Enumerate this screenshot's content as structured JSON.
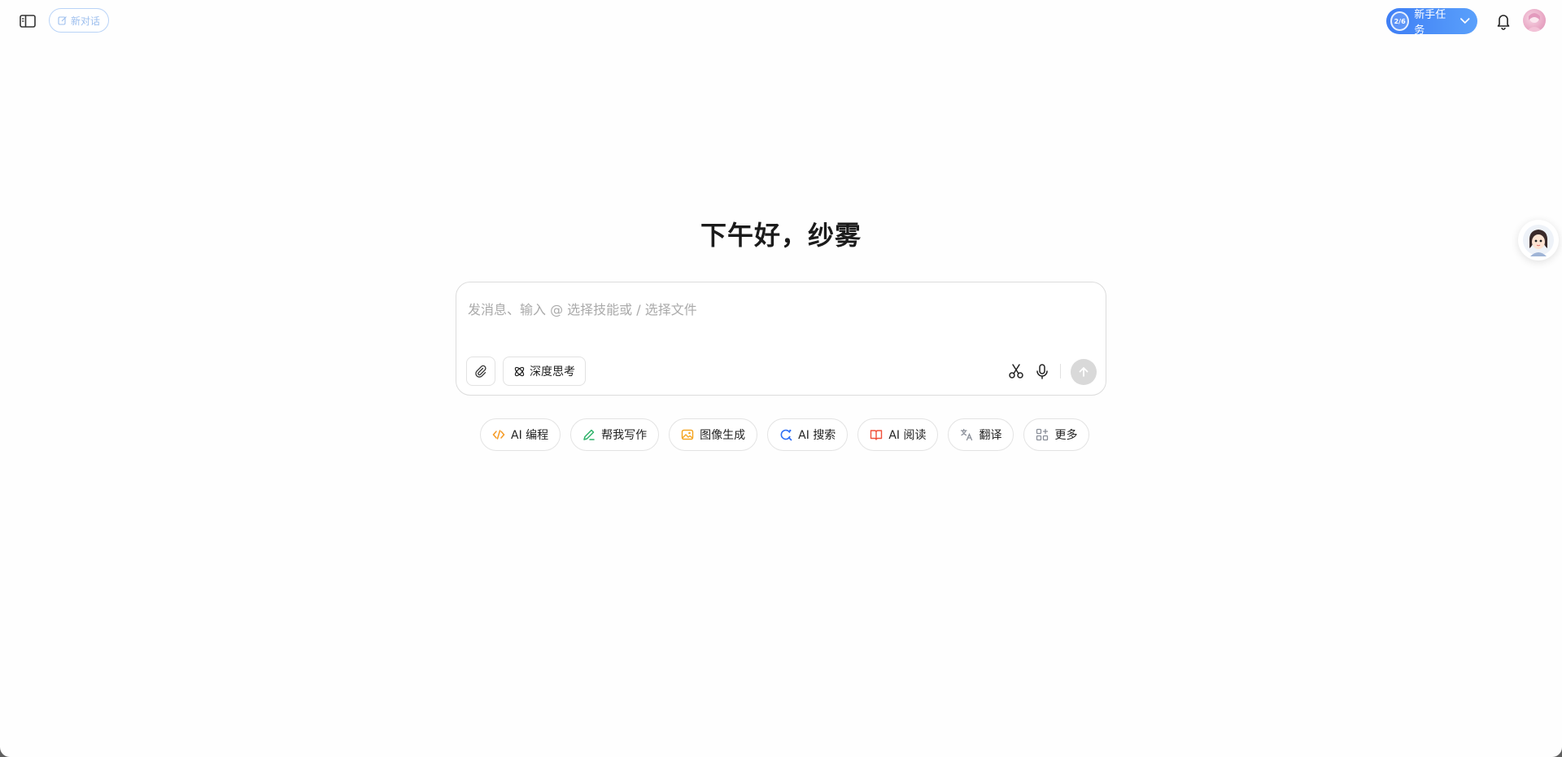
{
  "header": {
    "new_chat_label": "新对话",
    "task_progress": "2/6",
    "task_label": "新手任务"
  },
  "main": {
    "greeting": "下午好，纱雾"
  },
  "composer": {
    "placeholder": "发消息、输入 @ 选择技能或 / 选择文件",
    "deep_think_label": "深度思考"
  },
  "quick_actions": [
    {
      "label": "AI 编程",
      "icon": "code-icon",
      "color": "#f59a23"
    },
    {
      "label": "帮我写作",
      "icon": "pen-icon",
      "color": "#2fb36b"
    },
    {
      "label": "图像生成",
      "icon": "image-icon",
      "color": "#f5a623"
    },
    {
      "label": "AI 搜索",
      "icon": "search-icon",
      "color": "#2f6ef5"
    },
    {
      "label": "AI 阅读",
      "icon": "book-icon",
      "color": "#f0503a"
    },
    {
      "label": "翻译",
      "icon": "translate-icon",
      "color": "#8a8f99"
    },
    {
      "label": "更多",
      "icon": "grid-plus-icon",
      "color": "#8a8f99"
    }
  ],
  "colors": {
    "accent": "#3e7ef5",
    "send_disabled": "#d9d9d9"
  }
}
